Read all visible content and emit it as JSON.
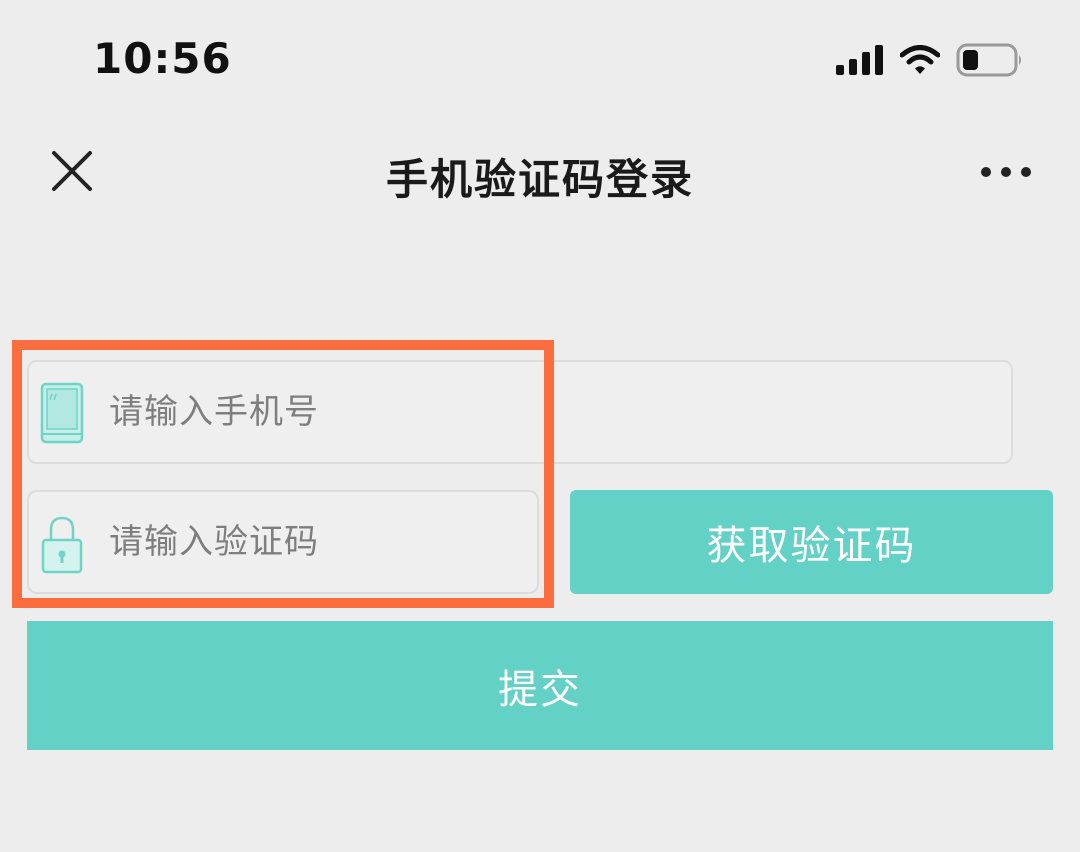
{
  "status_bar": {
    "time": "10:56",
    "signal_icon": "cellular-signal-icon",
    "wifi_icon": "wifi-icon",
    "battery_icon": "battery-icon"
  },
  "nav": {
    "title": "手机验证码登录",
    "close_icon": "close-icon",
    "more_icon": "more-icon"
  },
  "form": {
    "phone": {
      "placeholder": "请输入手机号",
      "value": "",
      "icon": "phone-icon"
    },
    "code": {
      "placeholder": "请输入验证码",
      "value": "",
      "icon": "lock-icon"
    },
    "get_code_label": "获取验证码",
    "submit_label": "提交"
  },
  "colors": {
    "accent": "#64d1c6",
    "highlight": "#fb6d3f",
    "background": "#ededed"
  }
}
